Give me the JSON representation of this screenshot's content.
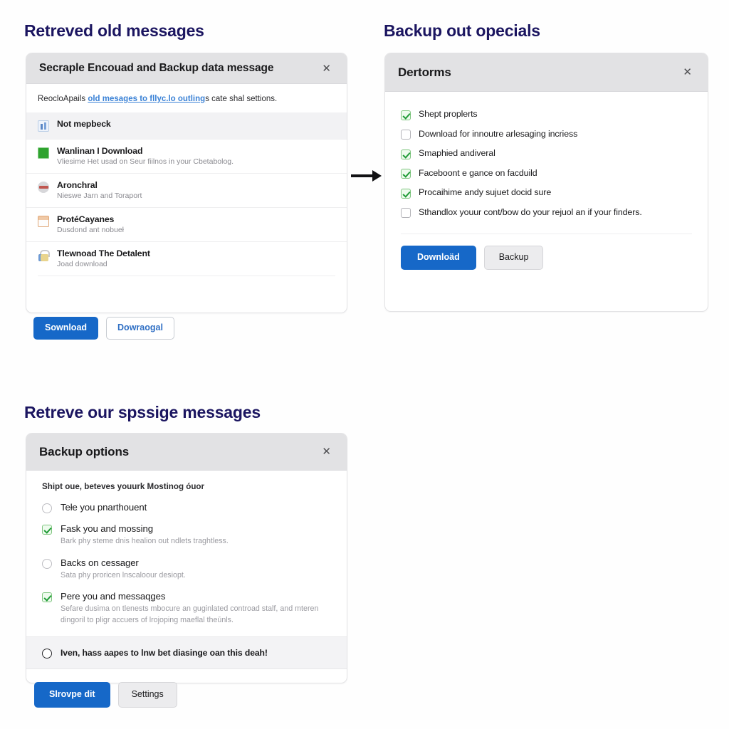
{
  "theme": {
    "title_color": "#1b1560",
    "primary_button": "#1668c8",
    "header_bg": "#e2e2e4",
    "check_green": "#1f9b36"
  },
  "panel_one": {
    "section_title": "Retreved old messages",
    "dialog_title": "Secraple Encouad and Backup data message",
    "close_icon": "close-icon",
    "intro": {
      "before": "ReocloApails ",
      "link": "old mesages to fllyc.lo outling",
      "after": "s cate shal settions."
    },
    "rows": [
      {
        "icon": "chart-icon",
        "title": "Not mepbeck",
        "sub": ""
      },
      {
        "icon": "green-square-icon",
        "title": "Wanlinan I Download",
        "sub": "Vliesime Het usad on Seur fiilnos in your Cbetabolog."
      },
      {
        "icon": "disc-icon",
        "title": "Aronchral",
        "sub": "Nieswe Jarn and Toraport"
      },
      {
        "icon": "window-icon",
        "title": "ProtéCayanes",
        "sub": "Dusdond ant nobueł"
      },
      {
        "icon": "lock-icon",
        "title": "Tlewnoad The Detalent",
        "sub": "Joad download"
      }
    ],
    "buttons": {
      "primary": "Sownload",
      "secondary": "Dowraogal"
    }
  },
  "arrow": {
    "icon": "arrow-right-icon"
  },
  "panel_two": {
    "section_title": "Backup out opecials",
    "dialog_title": "Dertorms",
    "close_icon": "close-icon",
    "items": [
      {
        "checked": true,
        "label": "Shept proplerts"
      },
      {
        "checked": false,
        "label": "Download for innoutre arlesaging incriess"
      },
      {
        "checked": true,
        "label": "Smaphied andiveral"
      },
      {
        "checked": true,
        "label": "Faceboont e gance on facduild"
      },
      {
        "checked": true,
        "label": "Procaihime andy sujuet docid sure"
      },
      {
        "checked": false,
        "label": "Sthandlox youur cont/bow do your rejuol an if your finders."
      }
    ],
    "buttons": {
      "primary": "Downloäd",
      "secondary": "Backup"
    }
  },
  "panel_three": {
    "section_title": "Retreve our spssige messages",
    "dialog_title": "Backup options",
    "close_icon": "close-icon",
    "intro": "Shipt oue, beteves youurk Mostinog óuor",
    "options": [
      {
        "control": "radio",
        "selected": false,
        "title": "Tełe you pnarthouent",
        "sub": ""
      },
      {
        "control": "checkbox",
        "selected": true,
        "title": "Fask you and mossing",
        "sub": "Bark phy steme dnis healion out ndlets traghtless."
      },
      {
        "control": "radio",
        "selected": false,
        "title": "Backs on cessager",
        "sub": "Sata phy proricen lnscaloour desiopt."
      },
      {
        "control": "checkbox",
        "selected": true,
        "title": "Pere you and messaqges",
        "sub": "Sefare dusima on tlenests mbocure an guginlated controad stalf, and mteren dingoril to pligr accuers of lrojoping maeflal theūnls."
      }
    ],
    "highlight": {
      "control": "radio",
      "selected": false,
      "label": "Iven, hass aapes to lnw bet diasinge oan this deah!"
    },
    "buttons": {
      "primary": "Slrovpe dit",
      "secondary": "Settings"
    }
  }
}
